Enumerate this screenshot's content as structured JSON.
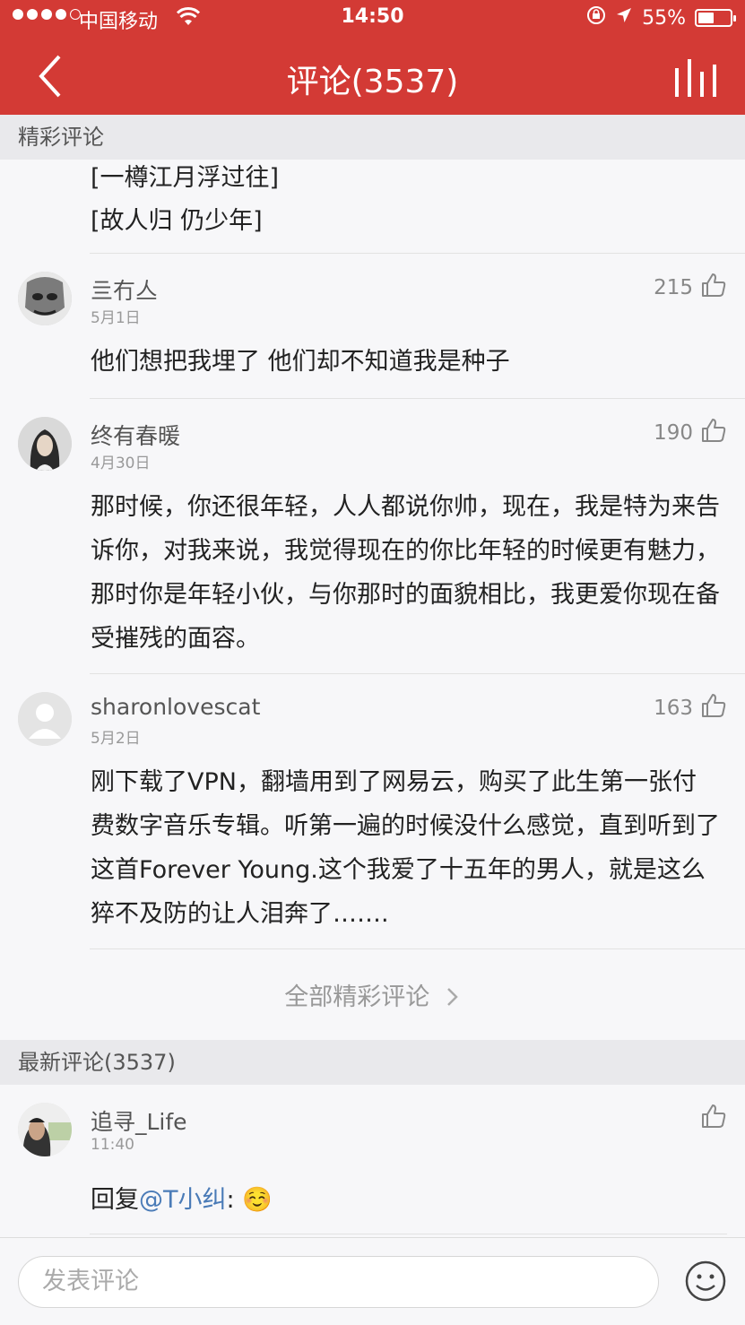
{
  "status": {
    "carrier": "中国移动",
    "time": "14:50",
    "battery": "55%",
    "battery_level": 0.55
  },
  "nav": {
    "title": "评论(3537)"
  },
  "hot_section": {
    "header": "精彩评论",
    "continued_lines": [
      "[一樽江月浮过往]",
      "[故人归  仍少年]"
    ],
    "comments": [
      {
        "username": "亖冇亼",
        "date": "5月1日",
        "likes": "215",
        "text": "他们想把我埋了 他们却不知道我是种子"
      },
      {
        "username": "终有春暖",
        "date": "4月30日",
        "likes": "190",
        "text": "那时候，你还很年轻，人人都说你帅，现在，我是特为来告诉你，对我来说，我觉得现在的你比年轻的时候更有魅力，那时你是年轻小伙，与你那时的面貌相比，我更爱你现在备受摧残的面容。"
      },
      {
        "username": "sharonlovescat",
        "date": "5月2日",
        "likes": "163",
        "text": "刚下载了VPN，翻墙用到了网易云，购买了此生第一张付费数字音乐专辑。听第一遍的时候没什么感觉，直到听到了这首Forever Young.这个我爱了十五年的男人，就是这么猝不及防的让人泪奔了……."
      }
    ],
    "more_label": "全部精彩评论"
  },
  "latest_section": {
    "header": "最新评论(3537)",
    "comments": [
      {
        "username": "追寻_Life",
        "date": "11:40",
        "reply_prefix": "回复",
        "mention": "@T小纠",
        "reply_suffix": ": ☺️"
      }
    ]
  },
  "compose": {
    "placeholder": "发表评论"
  },
  "colors": {
    "brand": "#d33a35",
    "mention": "#4a7bb7"
  }
}
